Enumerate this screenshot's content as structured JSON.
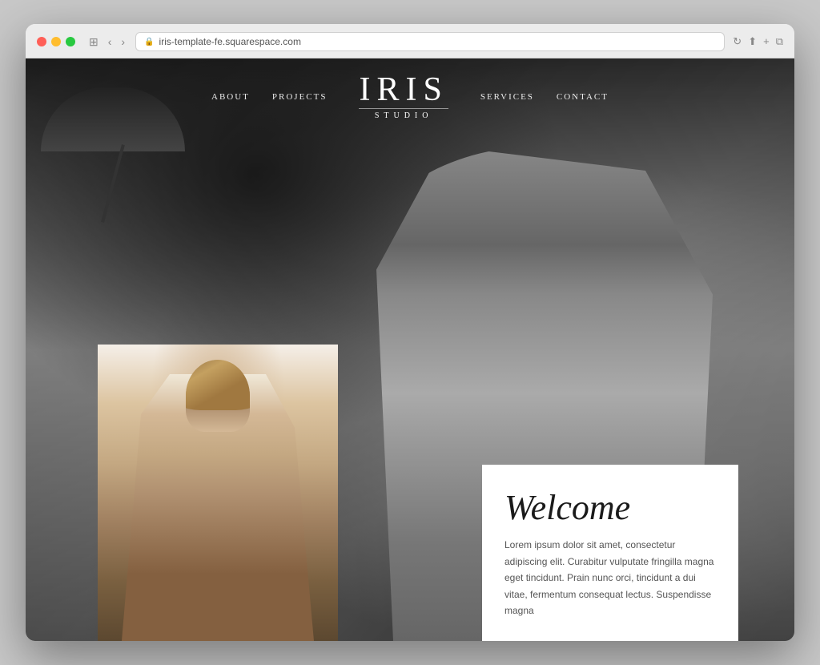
{
  "browser": {
    "url": "iris-template-fe.squarespace.com",
    "tab_icon": "🔒"
  },
  "nav": {
    "links_left": [
      "About",
      "Projects"
    ],
    "logo_title": "IRIS",
    "logo_subtitle": "STUDIO",
    "links_right": [
      "Services",
      "Contact"
    ]
  },
  "welcome": {
    "title": "Welcome",
    "body": "Lorem ipsum dolor sit amet, consectetur adipiscing elit. Curabitur vulputate fringilla magna eget tincidunt. Prain nunc orci, tincidunt a dui vitae, fermentum consequat lectus. Suspendisse magna"
  }
}
